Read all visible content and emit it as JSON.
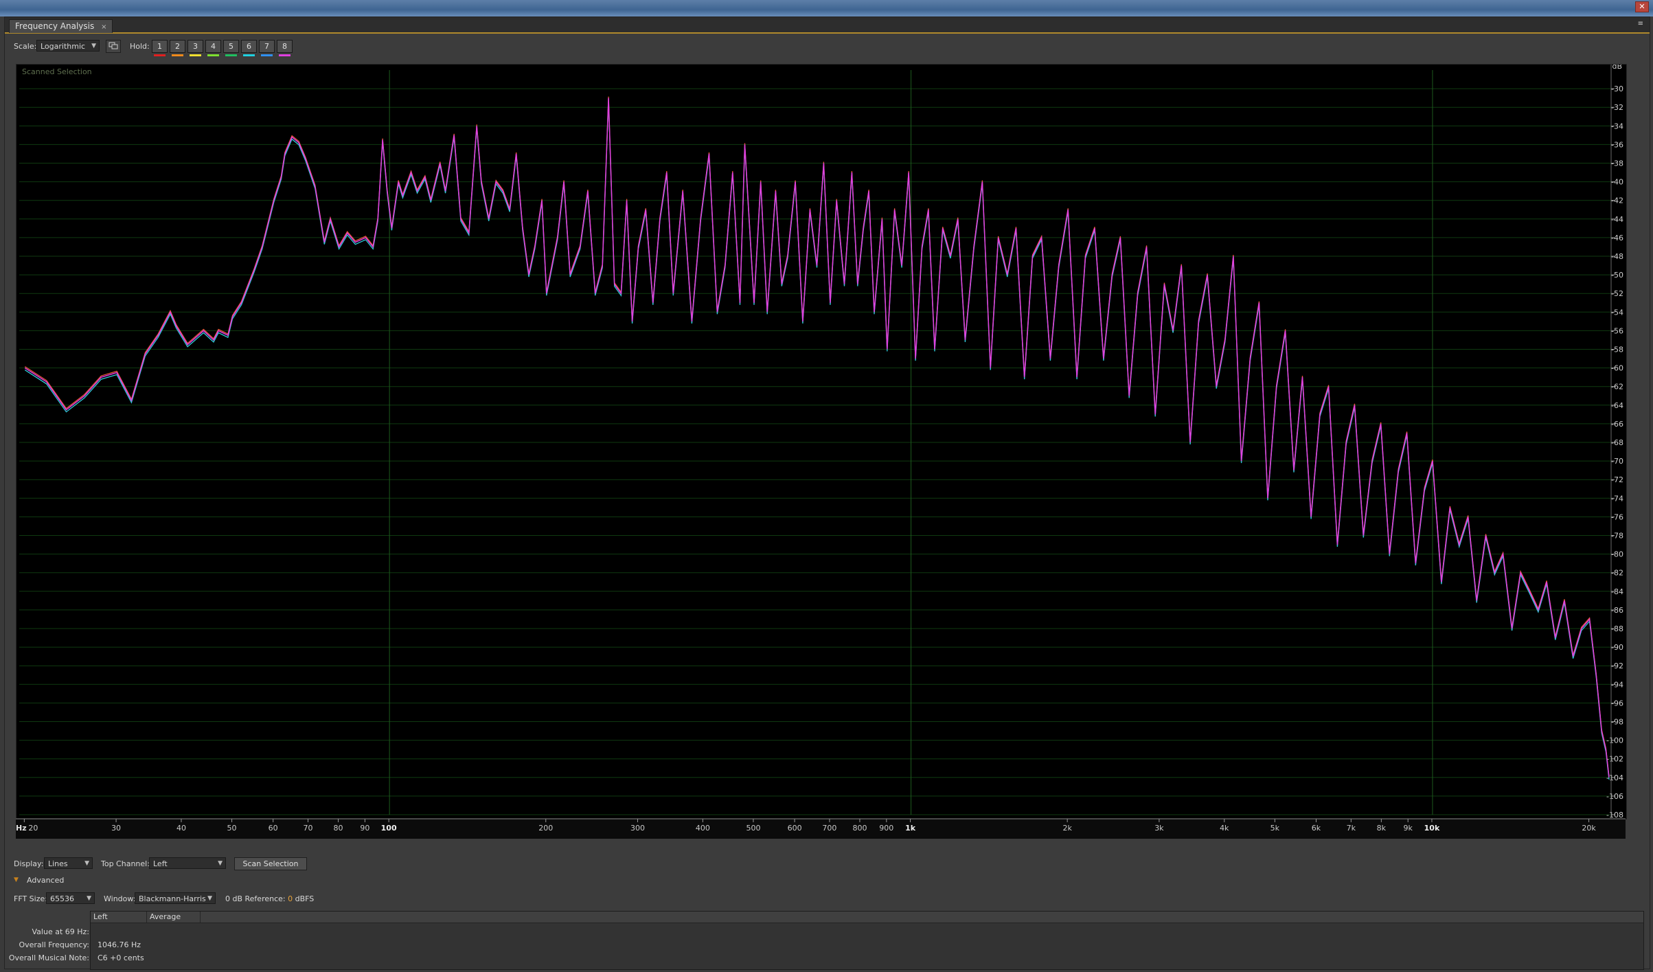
{
  "window": {
    "close_glyph": "✕"
  },
  "panel": {
    "tab_title": "Frequency Analysis",
    "tab_close": "×",
    "menu_glyph": "≡"
  },
  "toolbar": {
    "scale_label": "Scale:",
    "scale_value": "Logarithmic",
    "hold_label": "Hold:",
    "hold_buttons": [
      {
        "label": "1",
        "color": "#e02020"
      },
      {
        "label": "2",
        "color": "#f08a1c"
      },
      {
        "label": "3",
        "color": "#f2e030"
      },
      {
        "label": "4",
        "color": "#7ee030"
      },
      {
        "label": "5",
        "color": "#20c060"
      },
      {
        "label": "6",
        "color": "#20d0e0"
      },
      {
        "label": "7",
        "color": "#3090f0"
      },
      {
        "label": "8",
        "color": "#e040e0"
      }
    ],
    "snapshot_icon": "copy-icon"
  },
  "graph": {
    "corner_label": "Scanned Selection",
    "y_unit": "dB",
    "x_unit": "Hz",
    "y_ticks": [
      "-30",
      "-32",
      "-34",
      "-36",
      "-38",
      "-40",
      "-42",
      "-44",
      "-46",
      "-48",
      "-50",
      "-52",
      "-54",
      "-56",
      "-58",
      "-60",
      "-62",
      "-64",
      "-66",
      "-68",
      "-70",
      "-72",
      "-74",
      "-76",
      "-78",
      "-80",
      "-82",
      "-84",
      "-86",
      "-88",
      "-90",
      "-92",
      "-94",
      "-96",
      "-98",
      "-100",
      "-102",
      "-104",
      "-106",
      "-108"
    ],
    "x_ticks": [
      "20",
      "30",
      "40",
      "50",
      "60",
      "70",
      "80",
      "90",
      "100",
      "200",
      "300",
      "400",
      "500",
      "600",
      "700",
      "800",
      "900",
      "1k",
      "2k",
      "3k",
      "4k",
      "5k",
      "6k",
      "7k",
      "8k",
      "9k",
      "10k",
      "20k"
    ]
  },
  "chart_data": {
    "type": "line",
    "title": "",
    "xlabel": "Hz",
    "ylabel": "dB",
    "x_scale": "log",
    "xlim": [
      19.5,
      22000
    ],
    "ylim": [
      -108,
      -28
    ],
    "grid": true,
    "colors": {
      "left": "#e040e0",
      "average": "#30c8d8",
      "hold": "#f05a3a",
      "grid": "#0f3a10",
      "major_grid": "#1d5a1d"
    },
    "series": [
      {
        "values": [
          [
            20,
            -60
          ],
          [
            22,
            -61.5
          ],
          [
            24,
            -64.5
          ],
          [
            26,
            -63
          ],
          [
            28,
            -61
          ],
          [
            30,
            -60.5
          ],
          [
            32,
            -63.5
          ],
          [
            34,
            -58.5
          ],
          [
            36,
            -56.5
          ],
          [
            38,
            -54
          ],
          [
            39,
            -55.5
          ],
          [
            41,
            -57.5
          ],
          [
            42,
            -57
          ],
          [
            44,
            -56
          ],
          [
            46,
            -57
          ],
          [
            47,
            -56
          ],
          [
            49,
            -56.5
          ],
          [
            50,
            -54.5
          ],
          [
            52,
            -53
          ],
          [
            55,
            -49.5
          ],
          [
            57,
            -47
          ],
          [
            60,
            -42
          ],
          [
            62,
            -39.5
          ],
          [
            63,
            -37
          ],
          [
            65,
            -35.2
          ],
          [
            67,
            -35.8
          ],
          [
            69,
            -37.5
          ],
          [
            72,
            -40.5
          ],
          [
            75,
            -46.5
          ],
          [
            77,
            -44
          ],
          [
            80,
            -47
          ],
          [
            83,
            -45.5
          ],
          [
            86,
            -46.5
          ],
          [
            90,
            -46
          ],
          [
            93,
            -47
          ],
          [
            95,
            -44
          ],
          [
            97,
            -35.5
          ],
          [
            99,
            -41
          ],
          [
            101,
            -45
          ],
          [
            104,
            -40
          ],
          [
            106,
            -41.5
          ],
          [
            110,
            -39
          ],
          [
            113,
            -41
          ],
          [
            117,
            -39.5
          ],
          [
            120,
            -42
          ],
          [
            125,
            -38
          ],
          [
            128,
            -41
          ],
          [
            133,
            -35
          ],
          [
            137,
            -44
          ],
          [
            142,
            -45.5
          ],
          [
            147,
            -34
          ],
          [
            150,
            -40
          ],
          [
            155,
            -44
          ],
          [
            160,
            -40
          ],
          [
            165,
            -41
          ],
          [
            170,
            -43
          ],
          [
            175,
            -37
          ],
          [
            180,
            -45
          ],
          [
            185,
            -50
          ],
          [
            190,
            -47
          ],
          [
            196,
            -42
          ],
          [
            200,
            -52
          ],
          [
            210,
            -46
          ],
          [
            216,
            -40
          ],
          [
            222,
            -50
          ],
          [
            232,
            -47
          ],
          [
            240,
            -41
          ],
          [
            248,
            -52
          ],
          [
            256,
            -49
          ],
          [
            263,
            -31
          ],
          [
            270,
            -51
          ],
          [
            278,
            -52
          ],
          [
            285,
            -42
          ],
          [
            292,
            -55
          ],
          [
            300,
            -47
          ],
          [
            310,
            -43
          ],
          [
            320,
            -53
          ],
          [
            330,
            -44
          ],
          [
            340,
            -39
          ],
          [
            350,
            -52
          ],
          [
            365,
            -41
          ],
          [
            380,
            -55
          ],
          [
            395,
            -44
          ],
          [
            410,
            -37
          ],
          [
            425,
            -54
          ],
          [
            440,
            -49
          ],
          [
            455,
            -39
          ],
          [
            470,
            -53
          ],
          [
            480,
            -36
          ],
          [
            500,
            -53
          ],
          [
            515,
            -40
          ],
          [
            530,
            -54
          ],
          [
            550,
            -41
          ],
          [
            565,
            -51
          ],
          [
            580,
            -48
          ],
          [
            600,
            -40
          ],
          [
            620,
            -55
          ],
          [
            640,
            -43
          ],
          [
            660,
            -49
          ],
          [
            680,
            -38
          ],
          [
            700,
            -53
          ],
          [
            720,
            -42
          ],
          [
            745,
            -51
          ],
          [
            770,
            -39
          ],
          [
            790,
            -51
          ],
          [
            810,
            -45
          ],
          [
            830,
            -41
          ],
          [
            850,
            -54
          ],
          [
            880,
            -44
          ],
          [
            900,
            -58
          ],
          [
            930,
            -43
          ],
          [
            960,
            -49
          ],
          [
            990,
            -39
          ],
          [
            1020,
            -59
          ],
          [
            1050,
            -47
          ],
          [
            1080,
            -43
          ],
          [
            1110,
            -58
          ],
          [
            1150,
            -45
          ],
          [
            1190,
            -48
          ],
          [
            1230,
            -44
          ],
          [
            1270,
            -57
          ],
          [
            1320,
            -47
          ],
          [
            1370,
            -40
          ],
          [
            1420,
            -60
          ],
          [
            1470,
            -46
          ],
          [
            1530,
            -50
          ],
          [
            1590,
            -45
          ],
          [
            1650,
            -61
          ],
          [
            1710,
            -48
          ],
          [
            1780,
            -46
          ],
          [
            1850,
            -59
          ],
          [
            1920,
            -49
          ],
          [
            2000,
            -43
          ],
          [
            2080,
            -61
          ],
          [
            2160,
            -48
          ],
          [
            2250,
            -45
          ],
          [
            2340,
            -59
          ],
          [
            2430,
            -50
          ],
          [
            2520,
            -46
          ],
          [
            2620,
            -63
          ],
          [
            2720,
            -52
          ],
          [
            2830,
            -47
          ],
          [
            2940,
            -65
          ],
          [
            3060,
            -51
          ],
          [
            3180,
            -56
          ],
          [
            3300,
            -49
          ],
          [
            3430,
            -68
          ],
          [
            3560,
            -55
          ],
          [
            3700,
            -50
          ],
          [
            3850,
            -62
          ],
          [
            4000,
            -57
          ],
          [
            4150,
            -48
          ],
          [
            4300,
            -70
          ],
          [
            4470,
            -59
          ],
          [
            4650,
            -53
          ],
          [
            4830,
            -74
          ],
          [
            5020,
            -62
          ],
          [
            5220,
            -56
          ],
          [
            5420,
            -71
          ],
          [
            5630,
            -61
          ],
          [
            5850,
            -76
          ],
          [
            6080,
            -65
          ],
          [
            6320,
            -62
          ],
          [
            6570,
            -79
          ],
          [
            6830,
            -68
          ],
          [
            7090,
            -64
          ],
          [
            7370,
            -78
          ],
          [
            7660,
            -70
          ],
          [
            7960,
            -66
          ],
          [
            8270,
            -80
          ],
          [
            8600,
            -71
          ],
          [
            8930,
            -67
          ],
          [
            9280,
            -81
          ],
          [
            9650,
            -73
          ],
          [
            10000,
            -70
          ],
          [
            10400,
            -83
          ],
          [
            10800,
            -75
          ],
          [
            11250,
            -79
          ],
          [
            11700,
            -76
          ],
          [
            12150,
            -85
          ],
          [
            12650,
            -78
          ],
          [
            13150,
            -82
          ],
          [
            13650,
            -80
          ],
          [
            14200,
            -88
          ],
          [
            14750,
            -82
          ],
          [
            15350,
            -84
          ],
          [
            15950,
            -86
          ],
          [
            16550,
            -83
          ],
          [
            17200,
            -89
          ],
          [
            17900,
            -85
          ],
          [
            18600,
            -91
          ],
          [
            19300,
            -88
          ],
          [
            20000,
            -87
          ],
          [
            20600,
            -93
          ],
          [
            21100,
            -99
          ],
          [
            21500,
            -101
          ],
          [
            21800,
            -104
          ]
        ]
      }
    ]
  },
  "bottom": {
    "display_label": "Display:",
    "display_value": "Lines",
    "top_channel_label": "Top Channel:",
    "top_channel_value": "Left",
    "scan_button": "Scan Selection",
    "advanced_label": "Advanced",
    "advanced_arrow": "▼",
    "fft_label": "FFT Size:",
    "fft_value": "65536",
    "window_label": "Window:",
    "window_value": "Blackmann-Harris",
    "ref_label": "0 dB Reference:",
    "ref_value": "0",
    "ref_unit": "dBFS"
  },
  "results": {
    "col_left": "Left",
    "col_average": "Average",
    "rows": [
      {
        "label": "Value at 69 Hz:",
        "value": ""
      },
      {
        "label": "Overall Frequency:",
        "value": "1046.76 Hz"
      },
      {
        "label": "Overall Musical Note:",
        "value": "C6 +0 cents"
      }
    ]
  }
}
